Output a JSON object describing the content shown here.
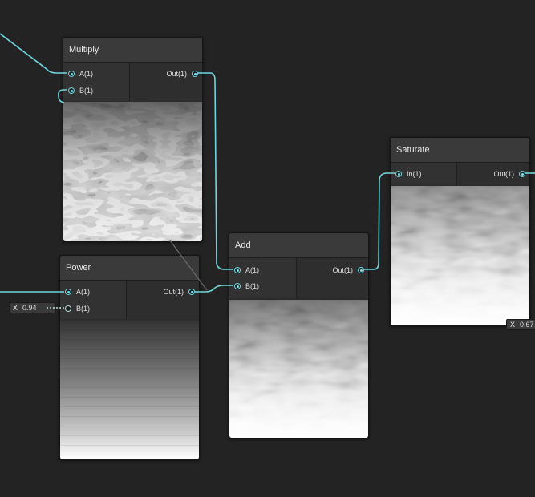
{
  "colors": {
    "background": "#232323",
    "wire": "#6fd6e0",
    "node_header": "#3a3a3a",
    "node_body": "#2b2b2b"
  },
  "nodes": {
    "multiply": {
      "title": "Multiply",
      "inputs": [
        "A(1)",
        "B(1)"
      ],
      "output": "Out(1)"
    },
    "power": {
      "title": "Power",
      "inputs": [
        "A(1)",
        "B(1)"
      ],
      "output": "Out(1)"
    },
    "add": {
      "title": "Add",
      "inputs": [
        "A(1)",
        "B(1)"
      ],
      "output": "Out(1)"
    },
    "saturate": {
      "title": "Saturate",
      "inputs": [
        "In(1)"
      ],
      "output": "Out(1)"
    }
  },
  "constants": {
    "power_b": {
      "axis": "X",
      "value": "0.94"
    },
    "saturate_right": {
      "axis": "X",
      "value": "0.67"
    }
  }
}
